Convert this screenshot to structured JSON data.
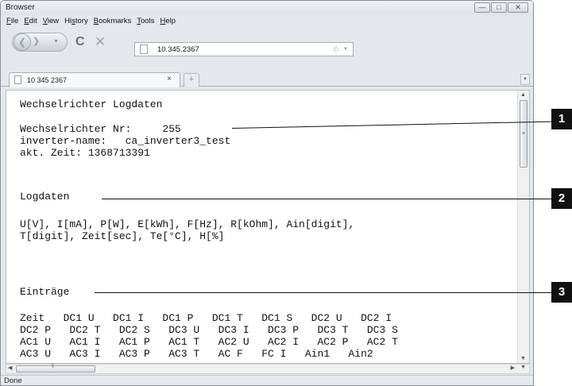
{
  "window": {
    "title": "Browser",
    "controls": {
      "minimize": "—",
      "maximize": "□",
      "close": "✕"
    }
  },
  "menu": [
    {
      "access": "F",
      "rest": "ile"
    },
    {
      "access": "E",
      "rest": "dit"
    },
    {
      "access": "V",
      "rest": "iew"
    },
    {
      "pre": "Hi",
      "access": "s",
      "rest": "tory"
    },
    {
      "access": "B",
      "rest": "ookmarks"
    },
    {
      "access": "T",
      "rest": "ools"
    },
    {
      "access": "H",
      "rest": "elp"
    }
  ],
  "navbar": {
    "url": "10.345.2367",
    "back_glyph": "❮",
    "forward_glyph": "❯",
    "reload_glyph": "C",
    "stop_glyph": "✕",
    "star_glyph": "☆"
  },
  "tab": {
    "label": "10 345 2367",
    "close_glyph": "×",
    "newtab_glyph": "+"
  },
  "content": {
    "heading": "Wechselrichter Logdaten",
    "inverter_lines": [
      "Wechselrichter Nr:     255",
      "inverter-name:   ca_inverter3_test",
      "akt. Zeit: 1368713391"
    ],
    "logdaten_heading": "Logdaten",
    "units_lines": [
      "U[V], I[mA], P[W], E[kWh], F[Hz], R[kOhm], Ain[digit],",
      "T[digit], Zeit[sec], Te[°C], H[%]"
    ],
    "eintraege_heading": "Einträge",
    "column_lines": [
      "Zeit   DC1 U   DC1 I   DC1 P   DC1 T   DC1 S   DC2 U   DC2 I",
      "DC2 P   DC2 T   DC2 S   DC3 U   DC3 I   DC3 P   DC3 T   DC3 S",
      "AC1 U   AC1 I   AC1 P   AC1 T   AC2 U   AC2 I   AC2 P   AC2 T",
      "AC3 U   AC3 I   AC3 P   AC3 T   AC F   FC I   Ain1   Ain2"
    ]
  },
  "status": {
    "text": "Done"
  },
  "callouts": [
    "1",
    "2",
    "3"
  ],
  "colors": {
    "badge": "#111111",
    "window_frame": "#e4e8ec"
  }
}
